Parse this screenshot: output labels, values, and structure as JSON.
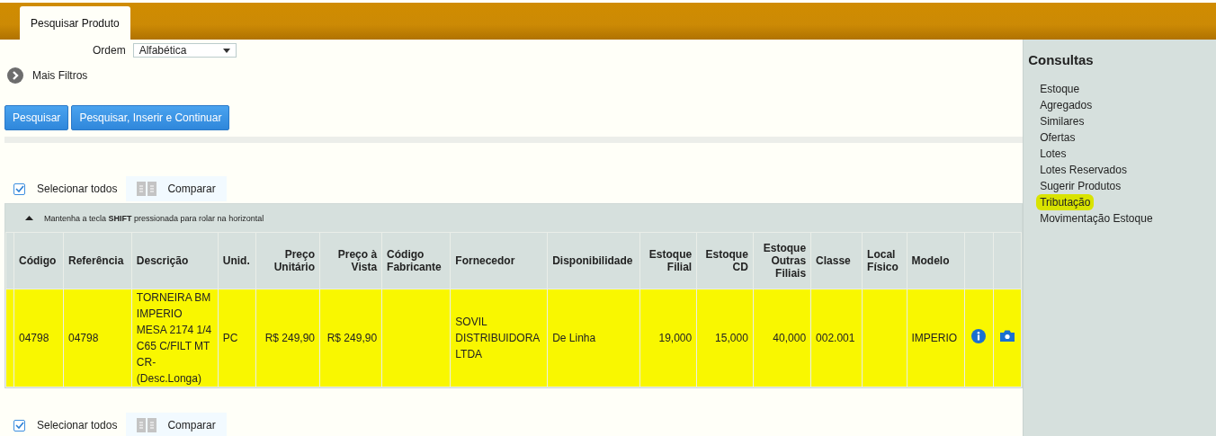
{
  "tabs": [
    {
      "label": "Pesquisar Produto",
      "selected": true
    }
  ],
  "order": {
    "label": "Ordem",
    "value": "Alfabética"
  },
  "more_filters": "Mais Filtros",
  "buttons": [
    "Pesquisar",
    "Pesquisar, Inserir e Continuar"
  ],
  "select_all_top": {
    "label": "Selecionar todos",
    "checked": true
  },
  "compare_top": "Comparar",
  "scroll_hint": "Mantenha a tecla **SHIFT** pressionada para rolar na horizontal",
  "table": {
    "columns": [
      "Código",
      "Referência",
      "Descrição",
      "Unid.",
      "Preço Unitário",
      "Preço à Vista",
      "Código Fabricante",
      "Fornecedor",
      "Disponibilidade",
      "Estoque Filial",
      "Estoque CD",
      "Estoque Outras Filiais",
      "Classe",
      "Local Físico",
      "Modelo"
    ],
    "rows": [
      {
        "selected": true,
        "cells": [
          "04798",
          "04798",
          "TORNEIRA BM IMPERIO MESA 2174 1/4 C65 C/FILT MT CR-(Desc.Longa)",
          "PC",
          "R$ 249,90",
          "R$ 249,90",
          "",
          "SOVIL DISTRIBUIDORA LTDA",
          "De Linha",
          "19,000",
          "15,000",
          "40,000",
          "002.001",
          "",
          "IMPERIO"
        ]
      }
    ]
  },
  "select_all_bottom": {
    "label": "Selecionar todos",
    "checked": true
  },
  "compare_bottom": "Comparar",
  "sidebar": {
    "title": "Consultas",
    "items": [
      {
        "label": "Estoque",
        "highlighted": false
      },
      {
        "label": "Agregados",
        "highlighted": false
      },
      {
        "label": "Similares",
        "highlighted": false
      },
      {
        "label": "Ofertas",
        "highlighted": false
      },
      {
        "label": "Lotes",
        "highlighted": false
      },
      {
        "label": "Lotes Reservados",
        "highlighted": false
      },
      {
        "label": "Sugerir Produtos",
        "highlighted": false
      },
      {
        "label": "Tributação",
        "highlighted": true
      },
      {
        "label": "Movimentação Estoque",
        "highlighted": false
      }
    ]
  }
}
